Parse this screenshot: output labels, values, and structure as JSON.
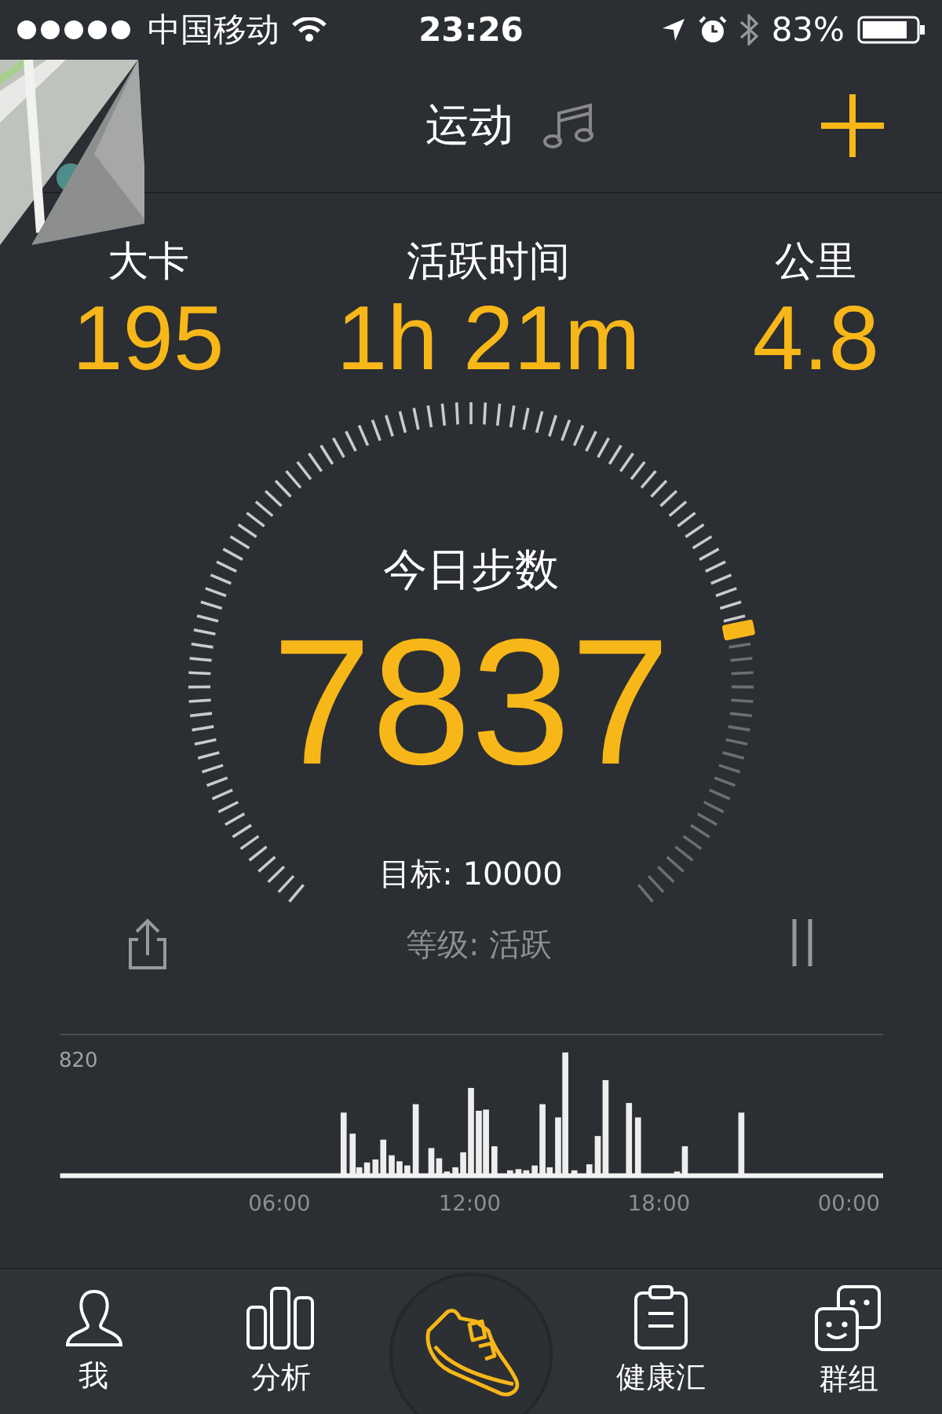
{
  "status_bar": {
    "carrier": "中国移动",
    "time": "23:26",
    "battery": "83%"
  },
  "header": {
    "title": "运动"
  },
  "stats": [
    {
      "label": "大卡",
      "value": "195"
    },
    {
      "label": "活跃时间",
      "value": "1h 21m"
    },
    {
      "label": "公里",
      "value": "4.8"
    }
  ],
  "steps": {
    "label": "今日步数",
    "count": "7837",
    "goal": "目标: 10000",
    "grade": "等级: 活跃"
  },
  "activity_chart": {
    "max_label": "820",
    "time_labels": [
      "06:00",
      "12:00",
      "18:00",
      "00:00"
    ]
  },
  "tab_bar": [
    {
      "label": "我",
      "selected": false
    },
    {
      "label": "分析",
      "selected": false
    },
    {
      "selected": true
    },
    {
      "label": "健康汇",
      "selected": false
    },
    {
      "label": "群组",
      "selected": false
    }
  ]
}
